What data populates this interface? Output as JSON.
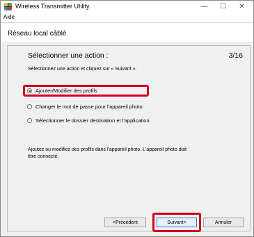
{
  "window": {
    "title": "Wireless Transmitter Utility",
    "minimize_glyph": "—",
    "maximize_glyph": "☐",
    "close_glyph": "✕"
  },
  "menu": {
    "help": "Aide"
  },
  "header": {
    "title": "Réseau local câblé"
  },
  "main": {
    "heading": "Sélectionner une action :",
    "step": "3/16",
    "instruction": "Sélectionnez une action et cliquez sur « Suivant ».",
    "options": [
      {
        "label": "Ajouter/Modifier des profils",
        "selected": true
      },
      {
        "label": "Changer le mot de passe pour l'appareil photo",
        "selected": false
      },
      {
        "label": "Sélectionner le dossier destination et l'application",
        "selected": false
      }
    ],
    "note": "Ajoutez ou modifiez des profils dans l'appareil photo. L'appareil photo doit être connecté."
  },
  "buttons": {
    "previous": "<Précédent",
    "next": "Suivant>",
    "cancel": "Annuler"
  },
  "colors": {
    "highlight": "#d0021b",
    "primary_border": "#3c78d8"
  },
  "icons": {
    "app": "app-icon"
  }
}
